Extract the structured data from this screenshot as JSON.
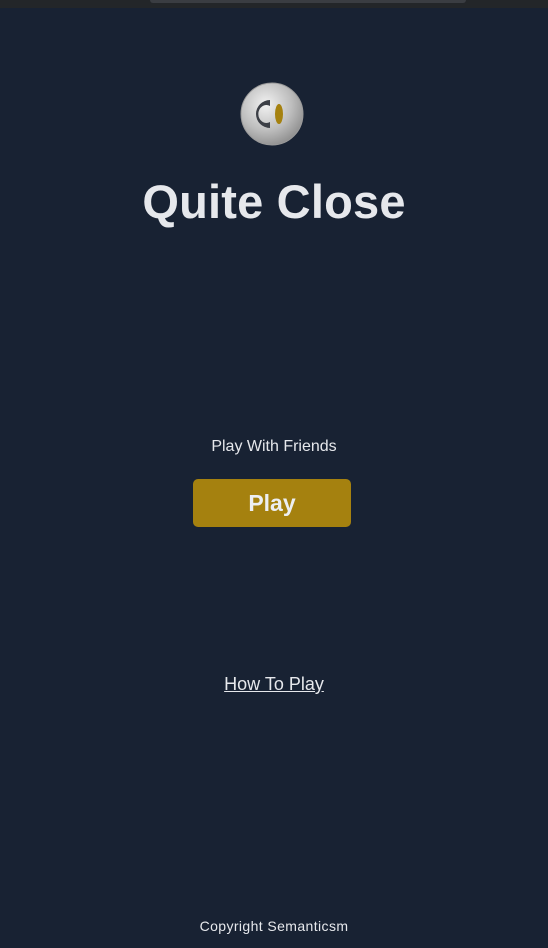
{
  "header": {
    "title": "Quite Close",
    "logo_icon": "quite-close-logo-icon"
  },
  "main": {
    "subtitle": "Play With Friends",
    "play_label": "Play",
    "how_to_play_label": "How To Play"
  },
  "footer": {
    "copyright": "Copyright Semanticsm"
  },
  "colors": {
    "background": "#182233",
    "accent": "#a5810f",
    "text": "#e6e8ec"
  }
}
